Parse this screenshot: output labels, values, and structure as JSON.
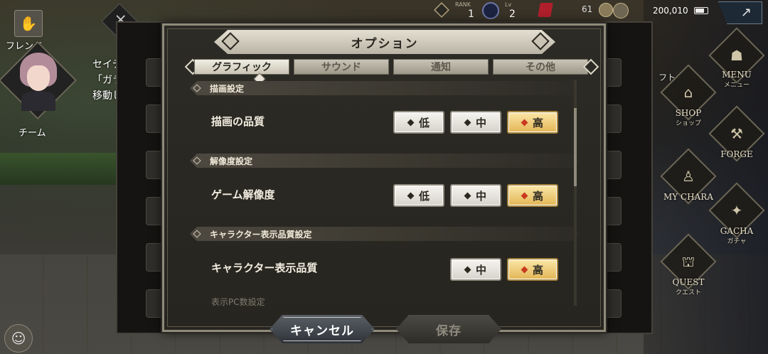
{
  "hud": {
    "rank_label": "RANK",
    "rank_value": "1",
    "lv_label": "Lv",
    "lv_value": "2",
    "stamina": "61",
    "money": "200,010",
    "menu_button_icon": "↗"
  },
  "left": {
    "friend_label": "フレンド",
    "team_label": "チーム",
    "npc_lines": [
      "セイテ",
      "「ガラ",
      "移動し"
    ]
  },
  "right_menu": [
    {
      "en": "MENU",
      "jp": "メニュー",
      "icon": "☗"
    },
    {
      "en": "SHOP",
      "jp": "ショップ",
      "icon": "⌂"
    },
    {
      "en": "FORGE",
      "jp": "",
      "icon": "⚒"
    },
    {
      "en": "MY CHARA",
      "jp": "",
      "icon": "♙"
    },
    {
      "en": "GACHA",
      "jp": "ガチャ",
      "icon": "✦"
    },
    {
      "en": "QUEST",
      "jp": "クエスト",
      "icon": "⛫"
    }
  ],
  "gift_label": "フト",
  "dialog": {
    "title": "オプション",
    "tabs": [
      {
        "label": "グラフィック",
        "state": "active"
      },
      {
        "label": "サウンド",
        "state": "inactive"
      },
      {
        "label": "通知",
        "state": "inactive"
      },
      {
        "label": "その他",
        "state": "inactive"
      }
    ],
    "sections": [
      {
        "header": "描画設定",
        "row_label": "描画の品質",
        "options": [
          "低",
          "中",
          "高"
        ],
        "selected": "高"
      },
      {
        "header": "解像度設定",
        "row_label": "ゲーム解像度",
        "options": [
          "低",
          "中",
          "高"
        ],
        "selected": "高"
      },
      {
        "header": "キャラクター表示品質設定",
        "row_label": "キャラクター表示品質",
        "options": [
          "中",
          "高"
        ],
        "selected": "高"
      }
    ],
    "partial_next": "表示PC数設定",
    "cancel_label": "キャンセル",
    "save_label": "保存"
  },
  "colors": {
    "selected_button": "#e2b555",
    "marker_selected": "#c9391f",
    "panel": "#2d2b26"
  }
}
